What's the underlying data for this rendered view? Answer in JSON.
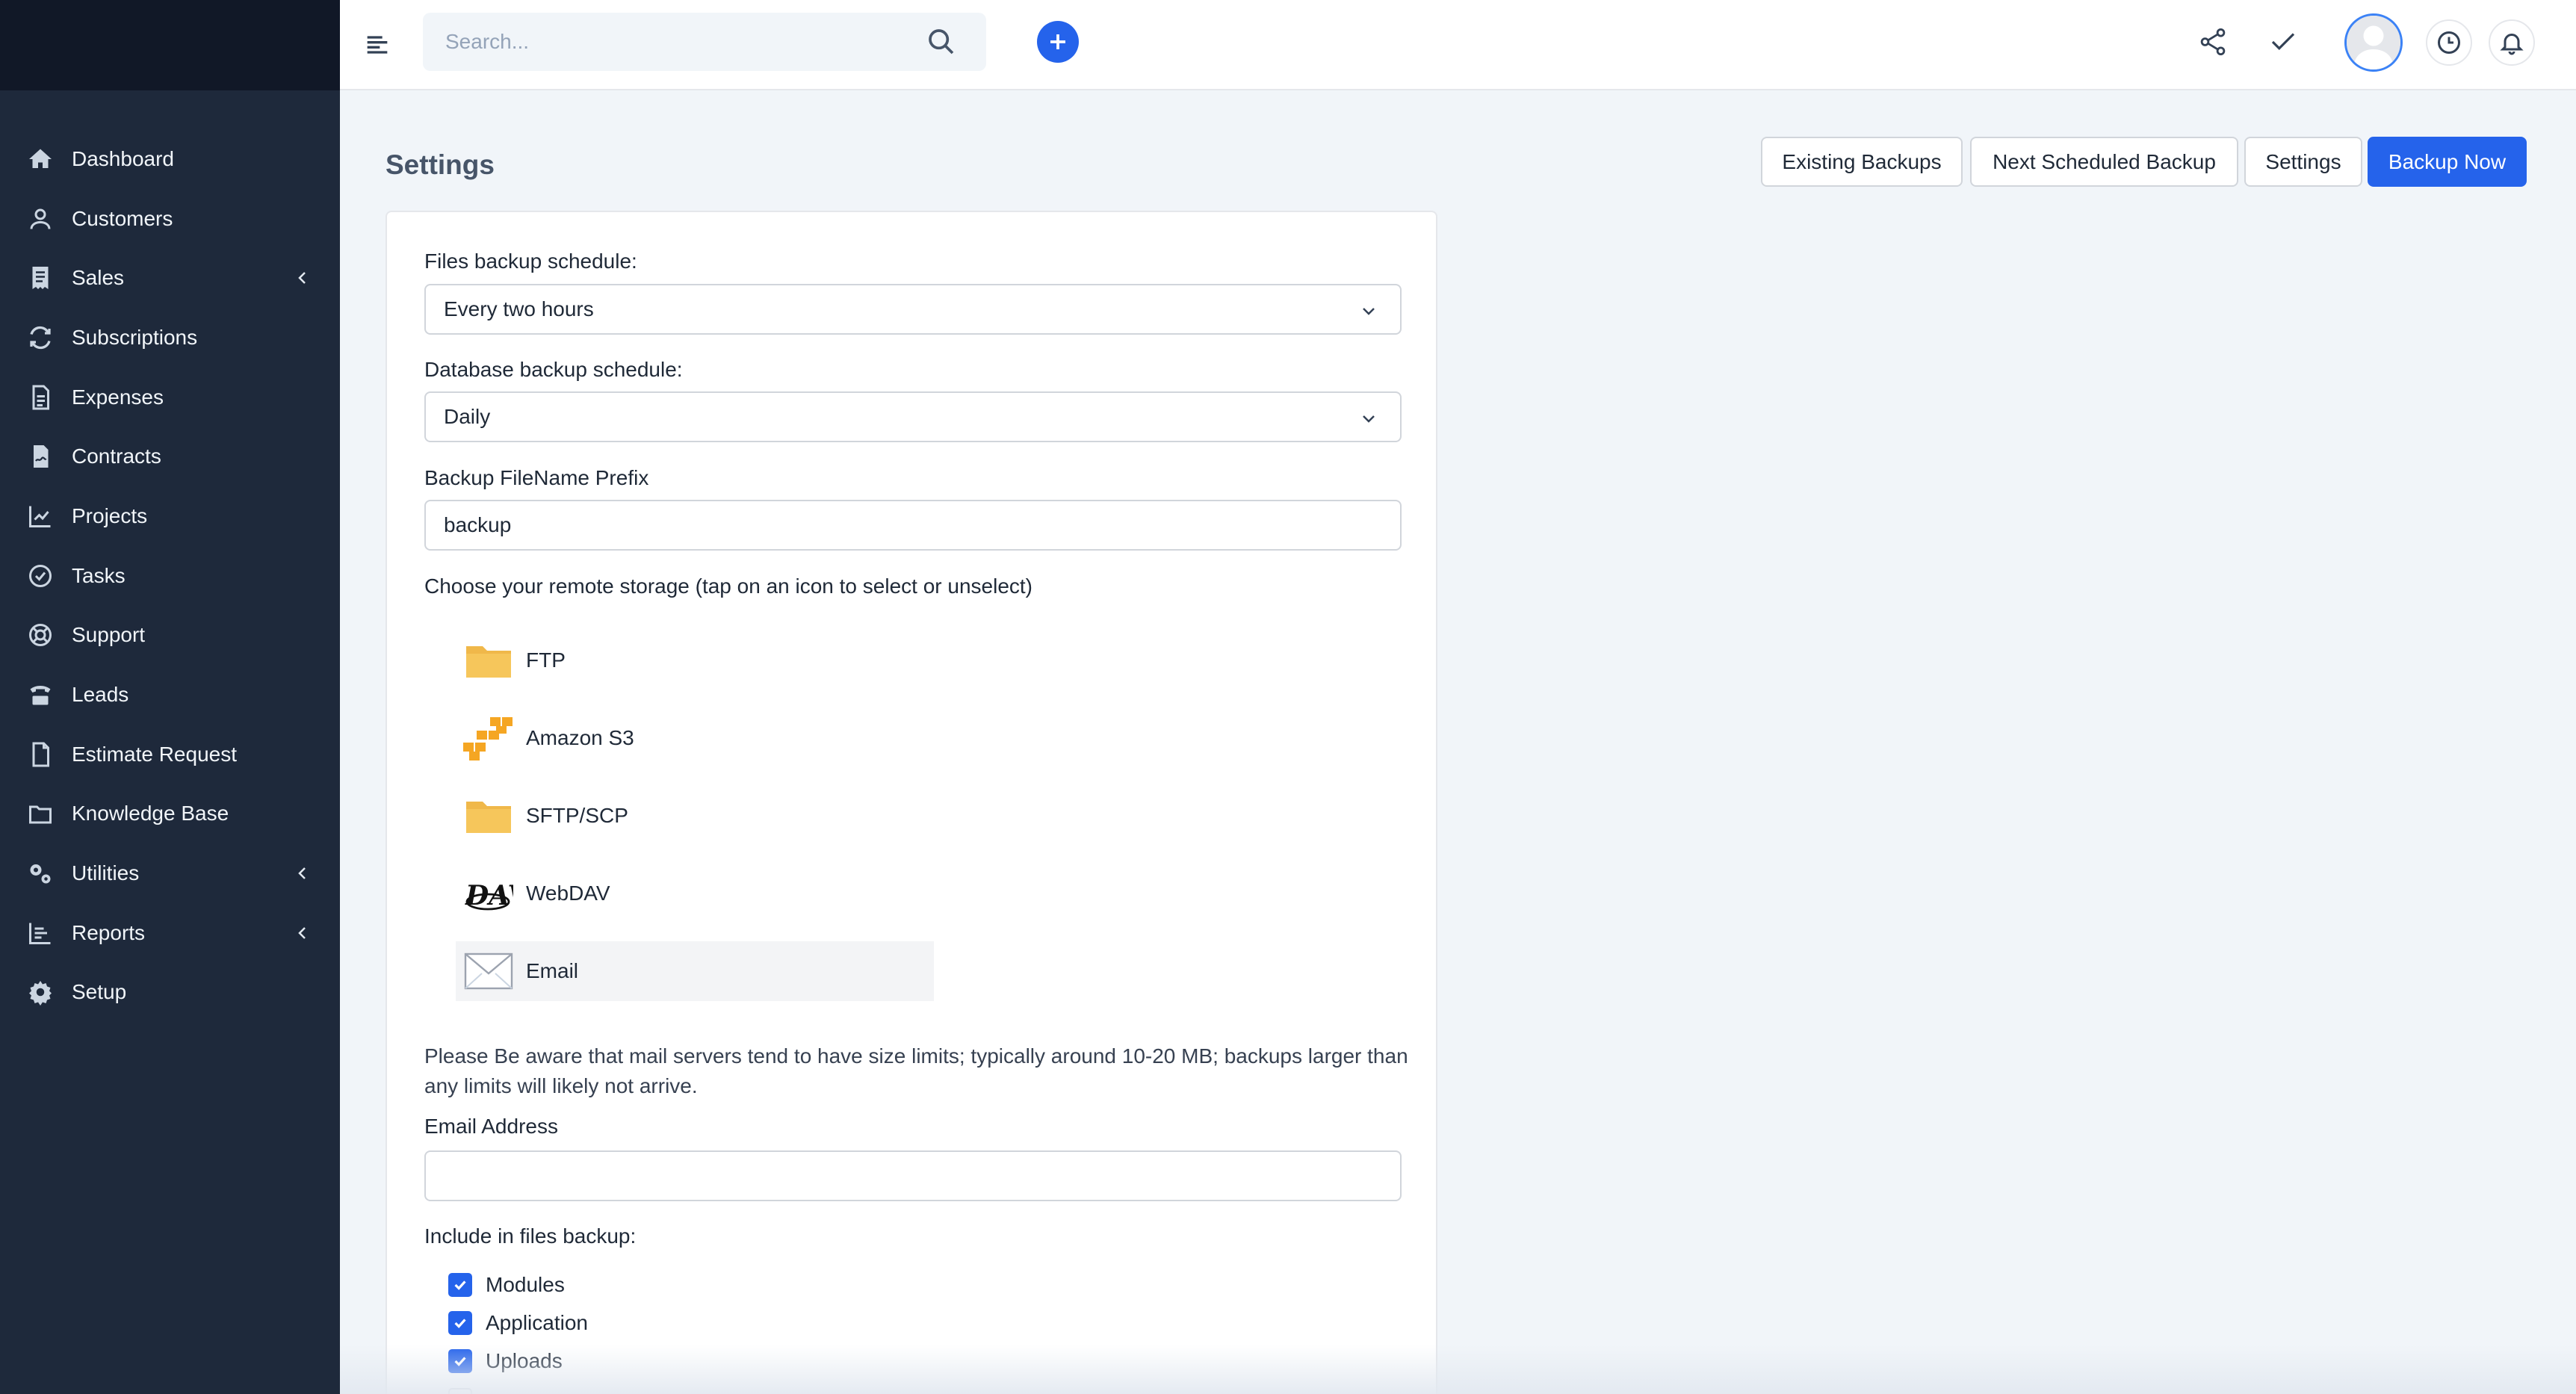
{
  "sidebar": {
    "items": [
      {
        "label": "Dashboard",
        "icon": "home-icon",
        "chevron": false
      },
      {
        "label": "Customers",
        "icon": "user-icon",
        "chevron": false
      },
      {
        "label": "Sales",
        "icon": "receipt-icon",
        "chevron": true
      },
      {
        "label": "Subscriptions",
        "icon": "refresh-icon",
        "chevron": false
      },
      {
        "label": "Expenses",
        "icon": "document-icon",
        "chevron": false
      },
      {
        "label": "Contracts",
        "icon": "contract-icon",
        "chevron": false
      },
      {
        "label": "Projects",
        "icon": "chart-icon",
        "chevron": false
      },
      {
        "label": "Tasks",
        "icon": "check-circle-icon",
        "chevron": false
      },
      {
        "label": "Support",
        "icon": "lifebuoy-icon",
        "chevron": false
      },
      {
        "label": "Leads",
        "icon": "tty-icon",
        "chevron": false
      },
      {
        "label": "Estimate Request",
        "icon": "file-icon",
        "chevron": false
      },
      {
        "label": "Knowledge Base",
        "icon": "folder-icon",
        "chevron": false
      },
      {
        "label": "Utilities",
        "icon": "cogs-icon",
        "chevron": true
      },
      {
        "label": "Reports",
        "icon": "bar-chart-icon",
        "chevron": true
      },
      {
        "label": "Setup",
        "icon": "gear-icon",
        "chevron": false
      }
    ]
  },
  "header": {
    "search_placeholder": "Search..."
  },
  "page": {
    "title": "Settings",
    "buttons": {
      "existing": "Existing Backups",
      "next": "Next Scheduled Backup",
      "settings": "Settings",
      "backup_now": "Backup Now"
    }
  },
  "form": {
    "files_label": "Files backup schedule:",
    "files_value": "Every two hours",
    "db_label": "Database backup schedule:",
    "db_value": "Daily",
    "prefix_label": "Backup FileName Prefix",
    "prefix_value": "backup",
    "storage_label": "Choose your remote storage (tap on an icon to select or unselect)",
    "storage": [
      {
        "label": "FTP",
        "icon": "folder-icon",
        "selected": false
      },
      {
        "label": "Amazon S3",
        "icon": "amazon-s3-icon",
        "selected": false
      },
      {
        "label": "SFTP/SCP",
        "icon": "folder-icon",
        "selected": false
      },
      {
        "label": "WebDAV",
        "icon": "webdav-icon",
        "selected": false
      },
      {
        "label": "Email",
        "icon": "envelope-icon",
        "selected": true
      }
    ],
    "note": "Please Be aware that mail servers tend to have size limits; typically around 10-20 MB; backups larger than any limits will likely not arrive.",
    "email_label": "Email Address",
    "email_value": "",
    "include_label": "Include in files backup:",
    "include": [
      {
        "label": "Modules",
        "checked": true
      },
      {
        "label": "Application",
        "checked": true
      },
      {
        "label": "Uploads",
        "checked": true
      }
    ]
  },
  "colors": {
    "sidebar_bg": "#1e293b",
    "accent": "#2563eb"
  }
}
